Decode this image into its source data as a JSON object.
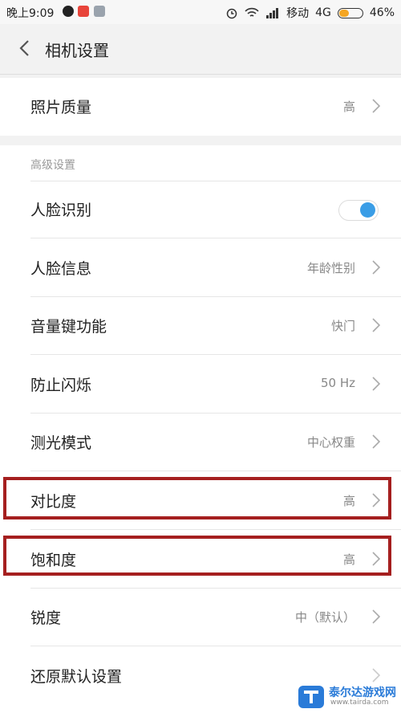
{
  "status_bar": {
    "time": "晚上9:09",
    "carrier": "移动",
    "network": "4G",
    "battery_text": "46%",
    "battery_level": 0.46,
    "icons": [
      "qq-icon",
      "app-icon",
      "notification-icon",
      "alarm-icon",
      "wifi-icon",
      "signal-icon",
      "battery-icon"
    ]
  },
  "header": {
    "back_icon": "chevron-left-icon",
    "title": "相机设置"
  },
  "photo_quality": {
    "label": "照片质量",
    "value": "高"
  },
  "advanced": {
    "header": "高级设置",
    "items": [
      {
        "label": "人脸识别",
        "type": "toggle",
        "checked": true
      },
      {
        "label": "人脸信息",
        "value": "年龄性别"
      },
      {
        "label": "音量键功能",
        "value": "快门"
      },
      {
        "label": "防止闪烁",
        "value": "50 Hz"
      },
      {
        "label": "测光模式",
        "value": "中心权重"
      },
      {
        "label": "对比度",
        "value": "高"
      },
      {
        "label": "饱和度",
        "value": "高"
      },
      {
        "label": "锐度",
        "value": "中（默认）"
      },
      {
        "label": "还原默认设置",
        "value": ""
      }
    ]
  },
  "colors": {
    "highlight_border": "#a51f1f",
    "toggle_on": "#3a9de6",
    "battery": "#f5a623"
  },
  "watermark": {
    "name": "泰尔达游戏网",
    "url": "www.tairda.com"
  }
}
